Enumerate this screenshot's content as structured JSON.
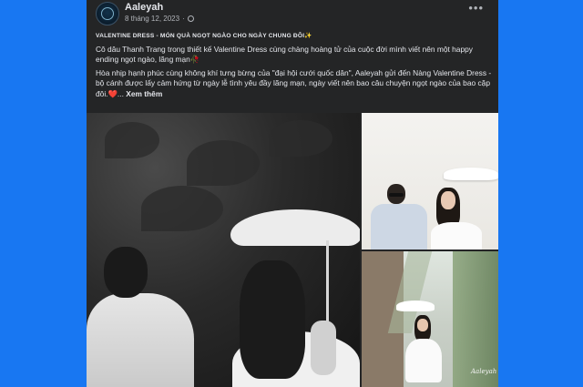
{
  "post": {
    "author": "Aaleyah",
    "date": "8 tháng 12, 2023",
    "headline": "VALENTINE DRESS - MÓN QUÀ NGỌT NGÀO CHO NGÀY CHUNG ĐÔI✨",
    "paragraph1": "Cô dâu Thanh Trang trong thiết kế Valentine Dress cùng chàng hoàng tử của cuộc đời mình viết nên một happy ending ngọt ngào, lãng mạn🥀",
    "paragraph2": "Hòa nhịp hạnh phúc cùng không khí tưng bừng của \"đại hội cưới quốc dân\", Aaleyah gửi đến Nàng Valentine Dress - bộ cánh được lấy cảm hứng từ ngày lễ tình yêu đầy lãng mạn, ngày viết nên bao câu chuyện ngọt ngào của bao cặp đôi.❤️...",
    "see_more": "Xem thêm",
    "more_glyph": "•••"
  },
  "photos": {
    "watermark": "Aaleyah"
  },
  "colors": {
    "page_background": "#1877f2",
    "card_background": "#242526",
    "text_primary": "#e4e6eb",
    "text_secondary": "#b0b3b8"
  },
  "icons": [
    "more-options-icon",
    "globe-icon",
    "avatar-logo-icon"
  ]
}
